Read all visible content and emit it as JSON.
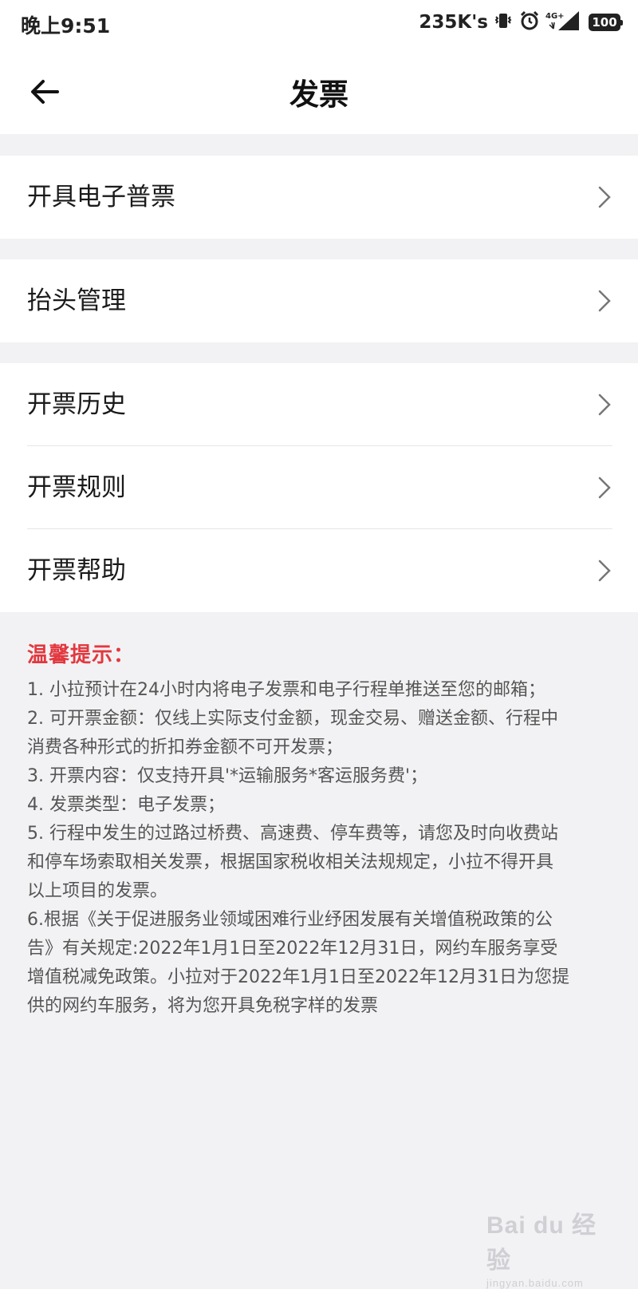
{
  "status_bar": {
    "time": "晚上9:51",
    "speed": "235K's",
    "battery": "100"
  },
  "header": {
    "title": "发票"
  },
  "menu_groups": [
    [
      {
        "label": "开具电子普票"
      }
    ],
    [
      {
        "label": "抬头管理"
      }
    ],
    [
      {
        "label": "开票历史"
      },
      {
        "label": "开票规则"
      },
      {
        "label": "开票帮助"
      }
    ]
  ],
  "tips": {
    "title": "温馨提示：",
    "lines": [
      "1. 小拉预计在24小时内将电子发票和电子行程单推送至您的邮箱；",
      "2. 可开票金额：仅线上实际支付金额，现金交易、赠送金额、行程中",
      "消费各种形式的折扣券金额不可开发票；",
      "3. 开票内容：仅支持开具'*运输服务*客运服务费'；",
      "4. 发票类型：电子发票；",
      "5. 行程中发生的过路过桥费、高速费、停车费等，请您及时向收费站",
      "和停车场索取相关发票，根据国家税收相关法规规定，小拉不得开具",
      "以上项目的发票。",
      "6.根据《关于促进服务业领域困难行业纾困发展有关增值税政策的公",
      "告》有关规定:2022年1月1日至2022年12月31日，网约车服务享受",
      "增值税减免政策。小拉对于2022年1月1日至2022年12月31日为您提",
      "供的网约车服务，将为您开具免税字样的发票"
    ]
  },
  "watermark": {
    "logo": "Bai du 经验",
    "sub": "jingyan.baidu.com"
  },
  "colors": {
    "accent_red": "#e2383f",
    "background": "#f2f2f4"
  }
}
